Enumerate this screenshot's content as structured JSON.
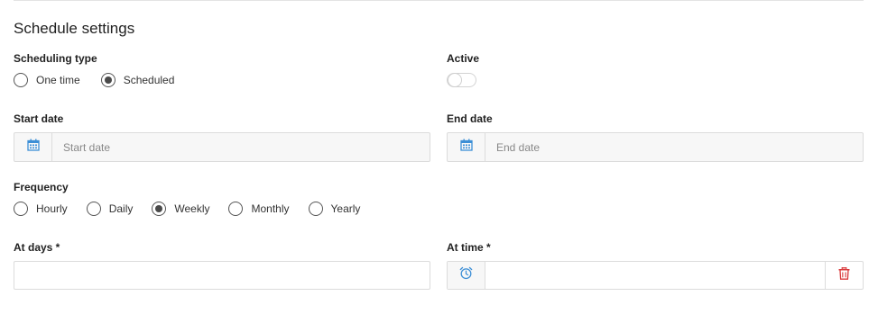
{
  "section": {
    "title": "Schedule settings"
  },
  "scheduling_type": {
    "label": "Scheduling type",
    "options": [
      "One time",
      "Scheduled"
    ],
    "selected": "Scheduled"
  },
  "active": {
    "label": "Active",
    "value": false
  },
  "start_date": {
    "label": "Start date",
    "placeholder": "Start date",
    "value": ""
  },
  "end_date": {
    "label": "End date",
    "placeholder": "End date",
    "value": ""
  },
  "frequency": {
    "label": "Frequency",
    "options": [
      "Hourly",
      "Daily",
      "Weekly",
      "Monthly",
      "Yearly"
    ],
    "selected": "Weekly"
  },
  "at_days": {
    "label": "At days *",
    "value": ""
  },
  "at_time": {
    "label": "At time *",
    "value": ""
  },
  "icons": {
    "calendar": "calendar-icon",
    "clock": "alarm-clock-icon",
    "delete": "trash-icon"
  },
  "colors": {
    "accent_blue": "#3d8fd6",
    "danger_red": "#d9383a"
  }
}
